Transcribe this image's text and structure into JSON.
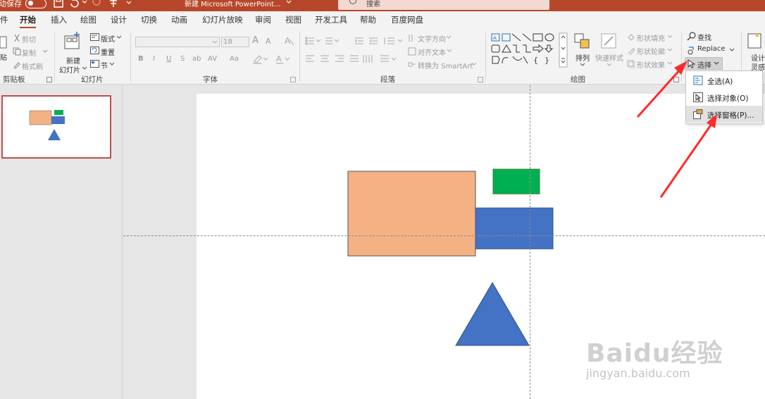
{
  "titlebar": {
    "autosave_label": "动保存",
    "doc_title": "新建 Microsoft PowerPoint...",
    "search_label": "搜索"
  },
  "tabs": [
    "件",
    "开始",
    "插入",
    "绘图",
    "设计",
    "切换",
    "动画",
    "幻灯片放映",
    "审阅",
    "视图",
    "开发工具",
    "帮助",
    "百度网盘"
  ],
  "ribbon": {
    "clipboard": {
      "paste": "贴",
      "cut": "剪切",
      "copy": "复制",
      "format_painter": "格式刷",
      "group_label": "剪贴板"
    },
    "slides": {
      "new_slide_line1": "新建",
      "new_slide_line2": "幻灯片",
      "layout": "版式",
      "reset": "重置",
      "section": "节",
      "group_label": "幻灯片"
    },
    "font": {
      "size": "18",
      "grow": "A",
      "shrink": "A",
      "bold": "B",
      "italic": "I",
      "underline": "U",
      "strike": "S",
      "shadow": "ab",
      "spacing": "AV",
      "case": "Aa",
      "group_label": "字体"
    },
    "paragraph": {
      "text_direction": "文字方向",
      "align_text": "对齐文本",
      "convert_smartart": "转换为 SmartArt",
      "group_label": "段落"
    },
    "drawing": {
      "arrange": "排列",
      "quick_styles": "快速样式",
      "shape_fill": "形状填充",
      "shape_outline": "形状轮廓",
      "shape_effects": "形状效果",
      "group_label": "绘图"
    },
    "editing": {
      "find": "查找",
      "replace": "Replace",
      "select": "选择"
    },
    "designer": {
      "line1": "设计",
      "line2": "灵感"
    }
  },
  "select_menu": {
    "items": [
      {
        "label": "全选(A)",
        "icon": "select-all-icon"
      },
      {
        "label": "选择对象(O)",
        "icon": "select-objects-icon"
      },
      {
        "label": "选择窗格(P)...",
        "icon": "selection-pane-icon"
      }
    ]
  },
  "watermark": {
    "logo": "Baidu经验",
    "url": "jingyan.baidu.com"
  },
  "colors": {
    "title_bar": "#b7472a",
    "orange_rect": "#f4b183",
    "blue_shape": "#4472c4",
    "green_rect": "#00b050",
    "thumb_border": "#c0504d",
    "arrow_red": "#ff2a2a"
  }
}
